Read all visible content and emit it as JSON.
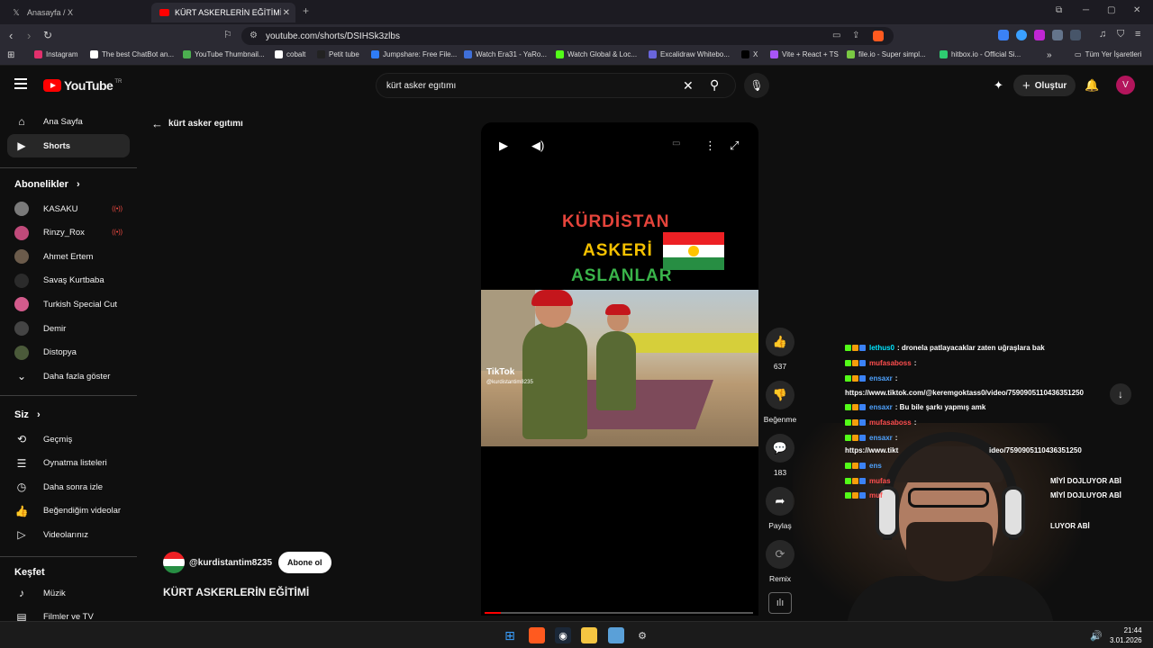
{
  "browser": {
    "tabs": [
      {
        "title": "Anasayfa / X",
        "icon": "x-logo-icon"
      },
      {
        "title": "KÜRT ASKERLERİN EĞİTİMİ - You",
        "icon": "youtube-icon"
      }
    ],
    "url": "youtube.com/shorts/DSIHSk3zlbs",
    "bookmarks": [
      {
        "label": "Instagram",
        "color": "#e1306c"
      },
      {
        "label": "The best ChatBot an...",
        "color": "#ffffff"
      },
      {
        "label": "YouTube Thumbnail...",
        "color": "#4caf50"
      },
      {
        "label": "cobalt",
        "color": "#ffffff"
      },
      {
        "label": "Petit tube",
        "color": "#222222"
      },
      {
        "label": "Jumpshare: Free File...",
        "color": "#2f7cf6"
      },
      {
        "label": "Watch Era31 - YaRo...",
        "color": "#3f6fd8"
      },
      {
        "label": "Watch Global & Loc...",
        "color": "#53fc18"
      },
      {
        "label": "Excalidraw Whitebo...",
        "color": "#6965db"
      },
      {
        "label": "X",
        "color": "#000000"
      },
      {
        "label": "Vite + React + TS",
        "color": "#a855f7"
      },
      {
        "label": "file.io - Super simpl...",
        "color": "#7ac943"
      },
      {
        "label": "hitbox.io - Official Si...",
        "color": "#2ecc71"
      }
    ],
    "bookmarks_folder": "Tüm Yer İşaretleri"
  },
  "youtube": {
    "logo_text": "YouTube",
    "region": "TR",
    "search_query": "kürt asker egıtımı",
    "create_label": "Oluştur",
    "avatar_letter": "V"
  },
  "sidebar": {
    "main": [
      {
        "label": "Ana Sayfa",
        "icon": "home-icon"
      },
      {
        "label": "Shorts",
        "icon": "shorts-icon"
      }
    ],
    "subscriptions_title": "Abonelikler",
    "subscriptions": [
      {
        "label": "KASAKU",
        "live": true,
        "color": "#7a7a7a"
      },
      {
        "label": "Rinzy_Rox",
        "live": true,
        "color": "#c04a7a"
      },
      {
        "label": "Ahmet Ertem",
        "live": false,
        "color": "#6b5b4b"
      },
      {
        "label": "Savaş Kurtbaba",
        "live": false,
        "color": "#2b2b2b"
      },
      {
        "label": "Turkish Special Cut",
        "live": false,
        "color": "#d35b8c"
      },
      {
        "label": "Demir",
        "live": false,
        "color": "#444444"
      },
      {
        "label": "Distopya",
        "live": false,
        "color": "#4b5a3a"
      }
    ],
    "show_more": "Daha fazla göster",
    "you_title": "Siz",
    "you_items": [
      {
        "label": "Geçmiş",
        "icon": "history-icon"
      },
      {
        "label": "Oynatma listeleri",
        "icon": "playlist-icon"
      },
      {
        "label": "Daha sonra izle",
        "icon": "clock-icon"
      },
      {
        "label": "Beğendiğim videolar",
        "icon": "thumbs-up-icon"
      },
      {
        "label": "Videolarınız",
        "icon": "video-icon"
      }
    ],
    "explore_title": "Keşfet",
    "explore_items": [
      {
        "label": "Müzik",
        "icon": "music-icon"
      },
      {
        "label": "Filmler ve TV",
        "icon": "film-icon"
      }
    ]
  },
  "shorts": {
    "back_label": "kürt asker egıtımı",
    "video_overlay_lines": [
      "KÜRDİSTAN",
      "ASKERİ",
      "ASLANLAR"
    ],
    "tiktok_label": "TikTok",
    "tiktok_handle": "@kurdistantim8235",
    "channel": "@kurdistantim8235",
    "subscribe_label": "Abone ol",
    "title": "KÜRT ASKERLERİN EĞİTİMİ",
    "progress": 0.06,
    "actions": [
      {
        "label": "637",
        "icon": "thumbs-up-icon"
      },
      {
        "label": "Beğenme",
        "icon": "thumbs-down-icon"
      },
      {
        "label": "183",
        "icon": "comment-icon"
      },
      {
        "label": "Paylaş",
        "icon": "share-icon"
      },
      {
        "label": "Remix",
        "icon": "remix-icon"
      }
    ]
  },
  "chat": [
    {
      "user": "lethus0",
      "user_color": "#00e5ff",
      "msg": ": dronela patlayacaklar zaten uğraşlara bak"
    },
    {
      "user": "mufasaboss",
      "user_color": "#ff4e4e",
      "msg": ":"
    },
    {
      "user": "ensaxr",
      "user_color": "#4fa3ff",
      "msg": ":"
    },
    {
      "user": "",
      "user_color": "#ffffff",
      "msg": "https://www.tiktok.com/@keremgoktass0/video/7590905110436351250"
    },
    {
      "user": "ensaxr",
      "user_color": "#4fa3ff",
      "msg": ": Bu bile şarkı yapmış amk"
    },
    {
      "user": "mufasaboss",
      "user_color": "#ff4e4e",
      "msg": ":"
    },
    {
      "user": "ensaxr",
      "user_color": "#4fa3ff",
      "msg": ":"
    },
    {
      "user": "",
      "user_color": "#ffffff",
      "msg": "https://www.tikt"
    },
    {
      "user": "",
      "user_color": "#ffffff",
      "msg": "ideo/7590905110436351250"
    },
    {
      "user": "ens",
      "user_color": "#4fa3ff",
      "msg": ""
    },
    {
      "user": "mufas",
      "user_color": "#ff4e4e",
      "msg": ""
    },
    {
      "user": "muf",
      "user_color": "#ff4e4e",
      "msg": ""
    },
    {
      "user": "",
      "user_color": "#ffffff",
      "msg": "MİYİ DOJLUYOR ABİ"
    },
    {
      "user": "",
      "user_color": "#ffffff",
      "msg": "MİYİ DOJLUYOR ABİ"
    },
    {
      "user": "",
      "user_color": "#ffffff",
      "msg": "LUYOR ABİ"
    }
  ],
  "taskbar": {
    "time": "21:44",
    "date": "3.01.2026"
  }
}
